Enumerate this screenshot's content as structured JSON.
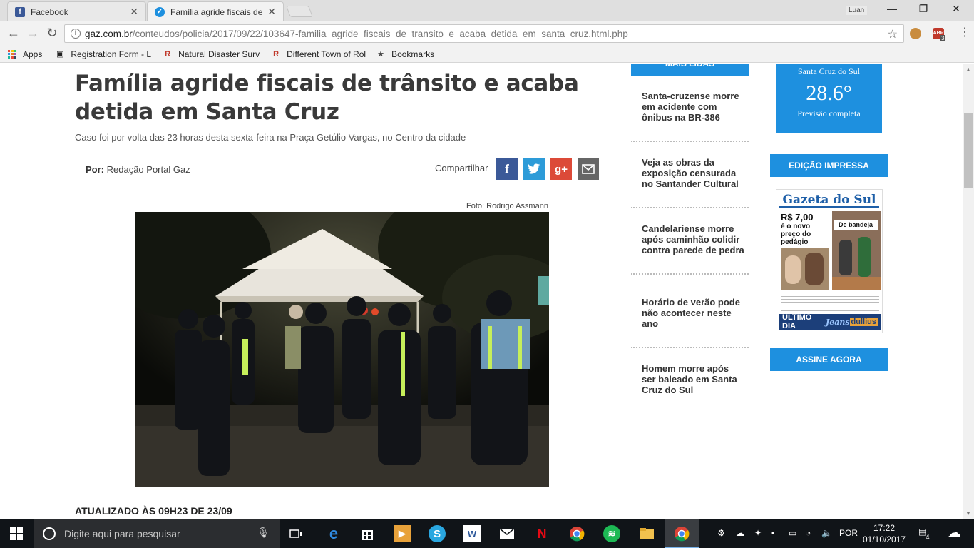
{
  "browser": {
    "tabs": [
      {
        "label": "Facebook",
        "active": false
      },
      {
        "label": "Família agride fiscais de t",
        "active": true
      }
    ],
    "profile_name": "Luan",
    "url_host": "gaz.com.br",
    "url_path": "/conteudos/policia/2017/09/22/103647-familia_agride_fiscais_de_transito_e_acaba_detida_em_santa_cruz.html.php",
    "extension_badge": "ABP",
    "extension_count": "3"
  },
  "bookmarks": [
    {
      "label": "Apps"
    },
    {
      "label": "Registration Form - L"
    },
    {
      "label": "Natural Disaster Surv"
    },
    {
      "label": "Different Town of Rol"
    },
    {
      "label": "Bookmarks"
    }
  ],
  "article": {
    "title": "Família agride fiscais de trânsito e acaba detida em Santa Cruz",
    "subtitle": "Caso foi por volta das 23 horas desta sexta-feira na Praça Getúlio Vargas, no Centro da cidade",
    "byline_prefix": "Por:",
    "author": "Redação Portal Gaz",
    "share_label": "Compartilhar",
    "photo_credit": "Foto: Rodrigo Assmann",
    "updated": "ATUALIZADO ÀS 09H23 DE 23/09"
  },
  "sidebar": {
    "most_read_header": "MAIS LIDAS",
    "most_read": [
      "Santa-cruzense morre em acidente com ônibus na BR-386",
      "Veja as obras da exposição censurada no Santander Cultural",
      "Candelariense morre após caminhão colidir contra parede de pedra",
      "Horário de verão pode não acontecer neste ano",
      "Homem morre após ser baleado em Santa Cruz do Sul"
    ],
    "weather_city": "Santa Cruz do Sul",
    "weather_temp": "28.6°",
    "weather_forecast": "Previsão completa",
    "print_edition_header": "EDIÇÃO IMPRESSA",
    "subscribe": "ASSINE AGORA",
    "cover": {
      "masthead": "Gazeta do Sul",
      "price": "R$ 7,00",
      "price_sub": "é o novo preço do pedágio",
      "story": "De bandeja",
      "ad_left": "ÚLTIMO DIA",
      "ad_brand": "Jeans",
      "ad_right": "dullius"
    }
  },
  "taskbar": {
    "search_placeholder": "Digite aqui para pesquisar",
    "language": "POR",
    "time": "17:22",
    "date": "01/10/2017",
    "notifications": "4"
  },
  "colors": {
    "accent_blue": "#1e90df",
    "facebook": "#3b5998",
    "twitter": "#2d9bd8",
    "google_plus": "#dc4a38",
    "email": "#666666"
  }
}
